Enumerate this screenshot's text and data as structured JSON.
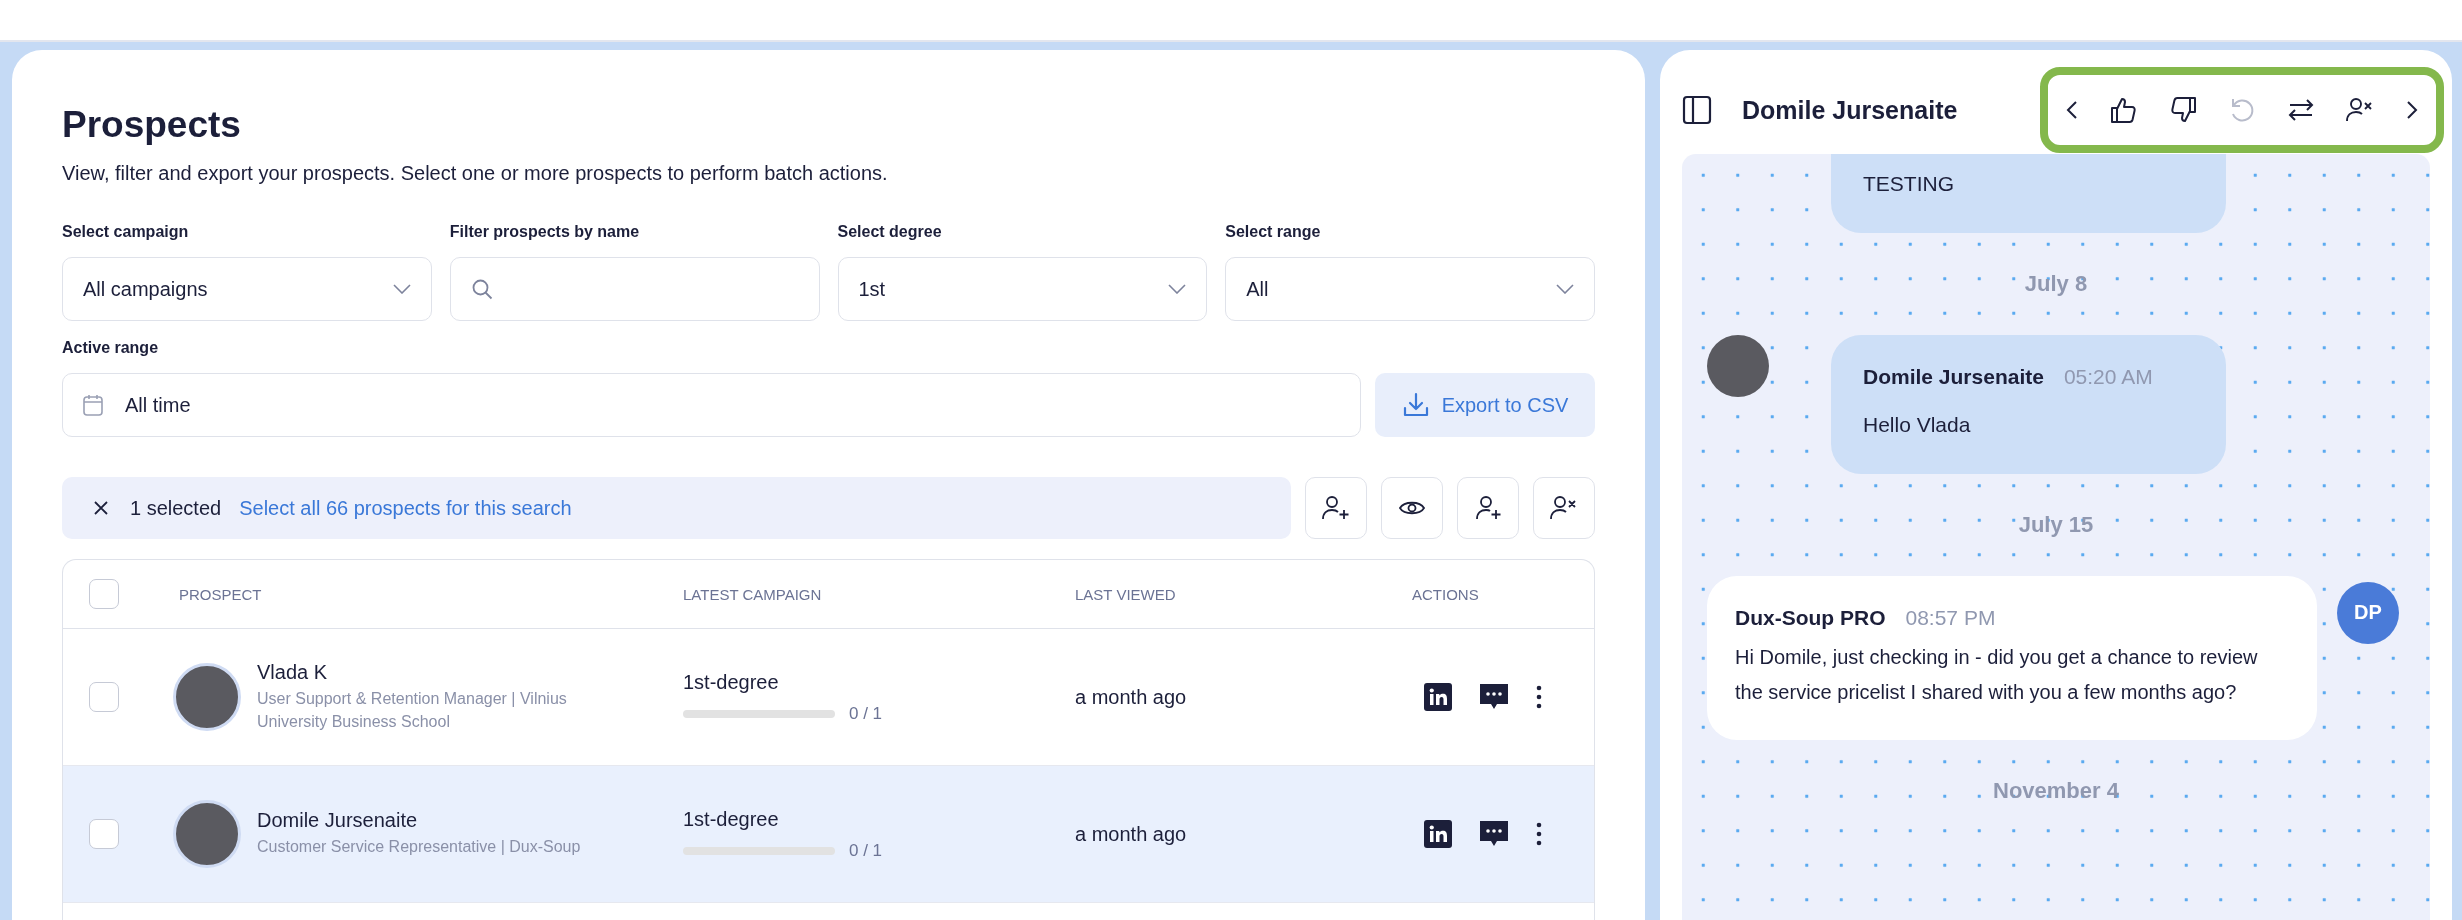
{
  "page": {
    "title": "Prospects",
    "subtitle": "View, filter and export your prospects. Select one or more prospects to perform batch actions."
  },
  "filters": [
    {
      "label": "Select campaign",
      "kind": "select",
      "value": "All campaigns"
    },
    {
      "label": "Filter prospects by name",
      "kind": "search"
    },
    {
      "label": "Select degree",
      "kind": "select",
      "value": "1st"
    },
    {
      "label": "Select range",
      "kind": "select",
      "value": "All"
    }
  ],
  "active_range": {
    "label": "Active range",
    "value": "All time"
  },
  "export_button": "Export to CSV",
  "selection_bar": {
    "count": "1 selected",
    "link": "Select all 66 prospects for this search"
  },
  "batch_actions": [
    {
      "kind": "add-to-campaign"
    },
    {
      "kind": "view"
    },
    {
      "kind": "connect"
    },
    {
      "kind": "remove"
    }
  ],
  "table": {
    "select_all_checked": false,
    "columns": [
      "PROSPECT",
      "LATEST CAMPAIGN",
      "LAST VIEWED",
      "ACTIONS"
    ],
    "rows": [
      {
        "selected": false,
        "checked": false,
        "name": "Vlada K",
        "headline": "User Support & Retention Manager | Vilnius University Business School",
        "campaign": "1st-degree",
        "level": 0,
        "progress": "0 / 1",
        "last_viewed": "a month ago"
      },
      {
        "selected": true,
        "checked": false,
        "name": "Domile Jursenaite",
        "headline": "Customer Service Representative | Dux-Soup",
        "campaign": "1st-degree",
        "level": 0,
        "progress": "0 / 1",
        "last_viewed": "a month ago"
      }
    ]
  },
  "conversation": {
    "title": "Domile Jursenaite",
    "toolbar": [
      {
        "kind": "previous",
        "disabled": false
      },
      {
        "kind": "like",
        "disabled": false
      },
      {
        "kind": "dislike",
        "disabled": false
      },
      {
        "kind": "undo",
        "disabled": true
      },
      {
        "kind": "swap",
        "disabled": false
      },
      {
        "kind": "remove",
        "disabled": false
      },
      {
        "kind": "next",
        "disabled": false
      }
    ],
    "items": [
      {
        "kind": "incoming",
        "text": "TESTING"
      },
      {
        "kind": "date",
        "text": "July 8"
      },
      {
        "kind": "incoming",
        "sender": "Domile Jursenaite",
        "time": "05:20 AM",
        "text": "Hello Vlada"
      },
      {
        "kind": "date",
        "text": "July 15"
      },
      {
        "kind": "outgoing",
        "sender": "Dux-Soup PRO",
        "time": "08:57 PM",
        "text": "Hi Domile, just checking in - did you get a chance to review the service pricelist I shared with you a few months ago?",
        "initials": "DP"
      },
      {
        "kind": "date",
        "text": "November 4"
      }
    ]
  }
}
